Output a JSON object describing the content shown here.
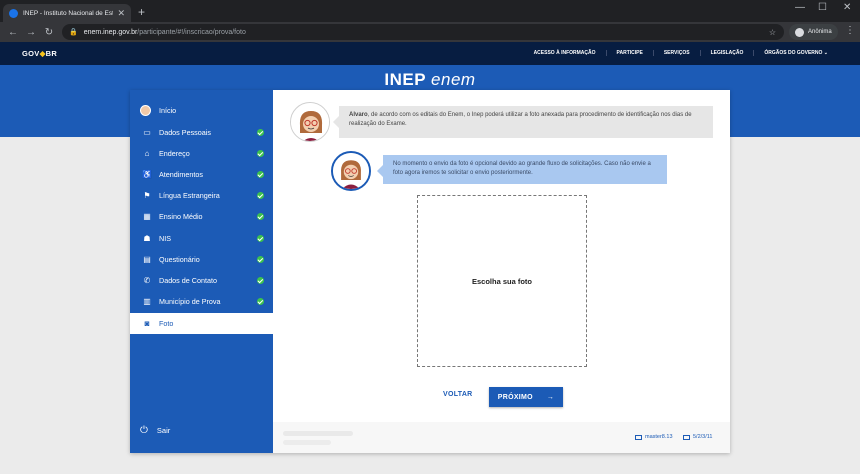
{
  "browser": {
    "tab_title": "INEP - Instituto Nacional de Estu",
    "new_tab": "+",
    "url_host": "enem.inep.gov.br",
    "url_path": "/participante/#!/inscricao/prova/foto",
    "profile_name": "Anônima"
  },
  "gov": {
    "logo_gov": "GOV",
    "logo_br": "BR",
    "links": [
      "ACESSO À INFORMAÇÃO",
      "PARTICIPE",
      "SERVIÇOS",
      "LEGISLAÇÃO",
      "ÓRGÃOS DO GOVERNO ⌄"
    ]
  },
  "brand": {
    "inep": "INEP",
    "enem": "enem"
  },
  "sidebar": {
    "items": [
      {
        "label": "Início",
        "icon": "user-avatar-icon",
        "done": false
      },
      {
        "label": "Dados Pessoais",
        "icon": "id-card-icon",
        "done": true
      },
      {
        "label": "Endereço",
        "icon": "home-icon",
        "done": true
      },
      {
        "label": "Atendimentos",
        "icon": "wheelchair-icon",
        "done": true
      },
      {
        "label": "Língua Estrangeira",
        "icon": "language-icon",
        "done": true
      },
      {
        "label": "Ensino Médio",
        "icon": "graduation-icon",
        "done": true
      },
      {
        "label": "NIS",
        "icon": "group-icon",
        "done": true
      },
      {
        "label": "Questionário",
        "icon": "clipboard-icon",
        "done": true
      },
      {
        "label": "Dados de Contato",
        "icon": "phone-icon",
        "done": true
      },
      {
        "label": "Município de Prova",
        "icon": "building-icon",
        "done": true
      },
      {
        "label": "Foto",
        "icon": "camera-icon",
        "done": false
      }
    ],
    "signout": "Sair"
  },
  "chat": {
    "msg1_name": "Alvaro",
    "msg1_text": ", de acordo com os editais do Enem, o Inep poderá utilizar a foto anexada para procedimento de identificação nos dias de realização do Exame.",
    "msg2_text": "No momento o envio da foto é opcional devido ao grande fluxo de solicitações. Caso não envie a foto agora iremos te solicitar o envio posteriormente."
  },
  "upload": {
    "label": "Escolha sua foto"
  },
  "actions": {
    "back": "VOLTAR",
    "next": "PRÓXIMO",
    "next_arrow": "→"
  },
  "footer": {
    "chip1": "master8.13",
    "chip2": "5/2/3/11"
  },
  "colors": {
    "primary": "#1c5bb6",
    "gov_bar": "#071d41",
    "success": "#3cc24d"
  }
}
